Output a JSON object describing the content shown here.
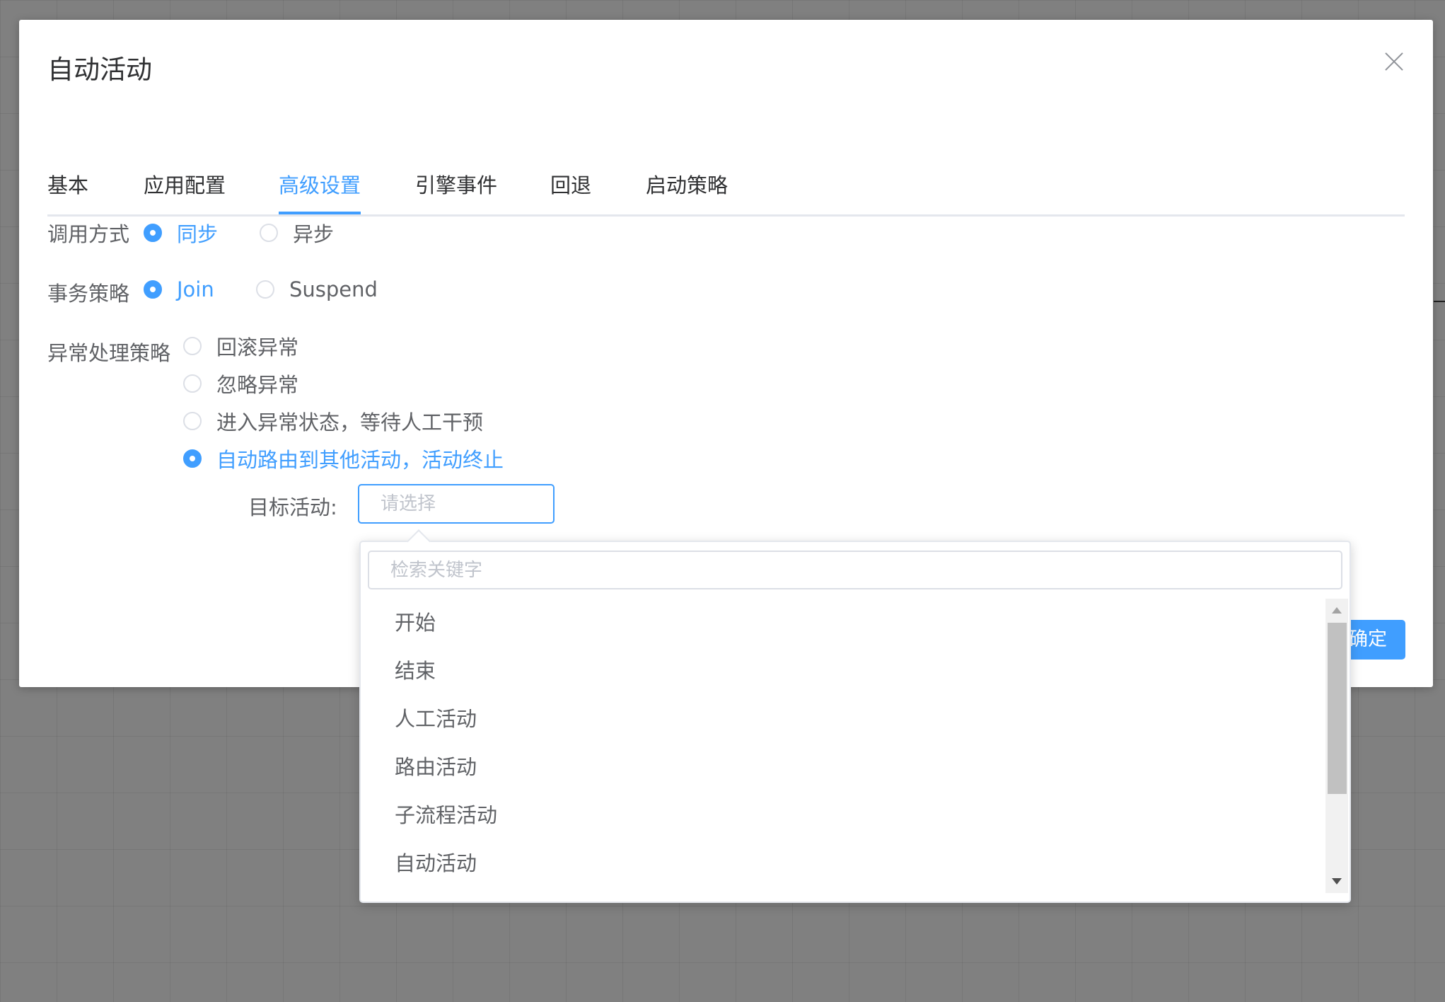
{
  "dialog": {
    "title": "自动活动",
    "close_icon": "close-icon"
  },
  "tabs": [
    {
      "label": "基本",
      "active": false
    },
    {
      "label": "应用配置",
      "active": false
    },
    {
      "label": "高级设置",
      "active": true
    },
    {
      "label": "引擎事件",
      "active": false
    },
    {
      "label": "回退",
      "active": false
    },
    {
      "label": "启动策略",
      "active": false
    }
  ],
  "form": {
    "call_mode": {
      "label": "调用方式",
      "options": [
        "同步",
        "异步"
      ],
      "selected": "同步"
    },
    "transaction_strategy": {
      "label": "事务策略",
      "options": [
        "Join",
        "Suspend"
      ],
      "selected": "Join"
    },
    "exception_strategy": {
      "label": "异常处理策略",
      "options": [
        "回滚异常",
        "忽略异常",
        "进入异常状态，等待人工干预",
        "自动路由到其他活动，活动终止"
      ],
      "selected": "自动路由到其他活动，活动终止"
    },
    "target_activity": {
      "label": "目标活动:",
      "placeholder": "请选择",
      "value": ""
    }
  },
  "dropdown": {
    "search_placeholder": "检索关键字",
    "items": [
      "开始",
      "结束",
      "人工活动",
      "路由活动",
      "子流程活动",
      "自动活动"
    ]
  },
  "footer": {
    "confirm_label": "确定"
  },
  "colors": {
    "accent": "#409eff",
    "overlay": "#808080",
    "text": "#606266",
    "title": "#303133"
  }
}
